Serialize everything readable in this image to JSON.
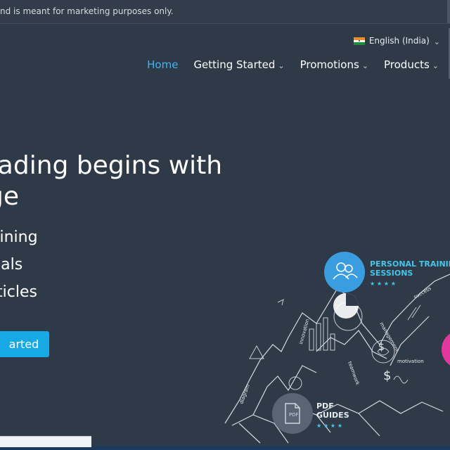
{
  "topbar": {
    "notice": "nd is meant for marketing purposes only."
  },
  "language": {
    "label": "English (India)"
  },
  "nav": {
    "items": [
      {
        "label": "Home"
      },
      {
        "label": "Getting Started"
      },
      {
        "label": "Promotions"
      },
      {
        "label": "Products"
      }
    ]
  },
  "hero": {
    "title_line1": "rading begins with",
    "title_line2": "ge",
    "list": [
      "aining",
      "rials",
      "rticles"
    ],
    "cta": "arted"
  },
  "features": {
    "personal_training_line1": "PERSONAL TRAINING",
    "personal_training_line2": "SESSIONS",
    "personal_training_stars": "★ ★ ★ ★",
    "pdf_line1": "PDF",
    "pdf_line2": "GUIDES",
    "pdf_stars": "★ ★ ★ ★",
    "pdf_icon_text": "PDF"
  },
  "colors": {
    "background": "#2f3a48",
    "accent": "#3fb6f0",
    "cta": "#17a8e6",
    "training_circle": "#3a9de0",
    "pink_circle": "#e2389b",
    "pdf_circle": "#5a6475"
  },
  "icons": [
    "india-flag-icon",
    "chevron-down-icon",
    "people-icon",
    "pdf-file-icon"
  ]
}
